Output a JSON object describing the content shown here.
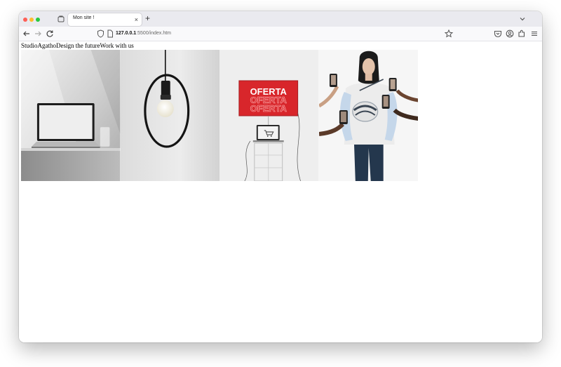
{
  "browser": {
    "tab": {
      "title": "Mon site !",
      "close": "×"
    },
    "new_tab": "+",
    "address": {
      "host": "127.0.0.1",
      "rest": ":5500/index.htm"
    }
  },
  "page": {
    "nav_links": [
      "Studio",
      "Agatho",
      "Design the future",
      "Work with us"
    ],
    "images": [
      {
        "name": "laptop-photo"
      },
      {
        "name": "pendant-lamp-photo"
      },
      {
        "name": "oferta-display-photo",
        "sign_text": "OFERTA"
      },
      {
        "name": "model-phones-photo"
      }
    ]
  },
  "colors": {
    "tabbar": "#eaeaef",
    "navbar": "#f9f9fb",
    "sign_red": "#d8262b"
  }
}
